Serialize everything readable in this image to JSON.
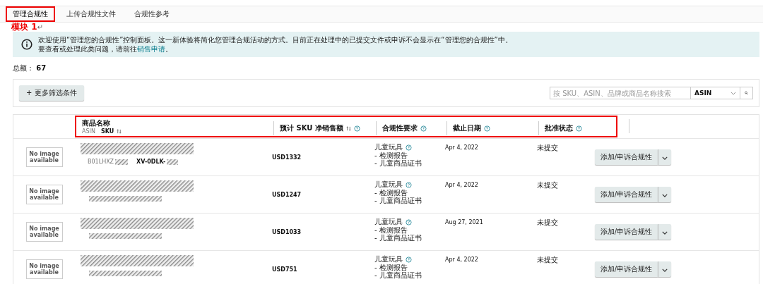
{
  "tabs": [
    {
      "label": "管理合规性",
      "selected": true,
      "highlighted": true
    },
    {
      "label": "上传合规性文件",
      "selected": false,
      "highlighted": false
    },
    {
      "label": "合规性参考",
      "selected": false,
      "highlighted": false
    }
  ],
  "annotation": {
    "label": "模块 1",
    "mark": "↵"
  },
  "info_banner": {
    "line_1": "欢迎使用“管理您的合规性”控制面板。这一新体验将简化您管理合规活动的方式。目前正在处理中的已提交文件或申诉不会显示在“管理您的合规性”中。",
    "line_2": "要查看或处理此类问题，请前往",
    "link": "销售申请",
    "line_2_end": "。"
  },
  "total": {
    "label": "总额：",
    "value": "67"
  },
  "filters": {
    "more_button": "+ 更多筛选条件",
    "search_placeholder": "按 SKU、ASIN、品牌或商品名称搜索",
    "search_type": "ASIN"
  },
  "table": {
    "highlighted": true,
    "columns": [
      {
        "label": "商品名称",
        "sub_1": "ASIN",
        "sub_2": "SKU",
        "sortable": true,
        "help": false
      },
      {
        "label": "预计 SKU 净销售额",
        "sortable": true,
        "help": true
      },
      {
        "label": "合规性要求",
        "sortable": false,
        "help": true
      },
      {
        "label": "截止日期",
        "sortable": false,
        "help": true
      },
      {
        "label": "批准状态",
        "sortable": false,
        "help": true
      }
    ],
    "rows": [
      {
        "image_text": "No image available",
        "asin": "B01LHXZ",
        "sku": "XV-0DLK-",
        "sales": "USD1332",
        "requirement": "儿童玩具",
        "documents": [
          "- 检测报告",
          "- 儿童商品证书"
        ],
        "due_date": "Apr 4, 2022",
        "status": "未提交",
        "action": "添加/申诉合规性"
      },
      {
        "image_text": "No image available",
        "sales": "USD1247",
        "requirement": "儿童玩具",
        "documents": [
          "- 检测报告",
          "- 儿童商品证书"
        ],
        "due_date": "Apr 4, 2022",
        "status": "未提交",
        "action": "添加/申诉合规性"
      },
      {
        "image_text": "No image available",
        "sales": "USD1033",
        "requirement": "儿童玩具",
        "documents": [
          "- 检测报告",
          "- 儿童商品证书"
        ],
        "due_date": "Aug 27, 2021",
        "status": "未提交",
        "action": "添加/申诉合规性"
      },
      {
        "image_text": "No image available",
        "sales": "USD751",
        "requirement": "儿童玩具",
        "documents": [
          "- 检测报告",
          "- 儿童商品证书"
        ],
        "due_date": "Apr 4, 2022",
        "status": "未提交",
        "action": "添加/申诉合规性"
      }
    ]
  }
}
